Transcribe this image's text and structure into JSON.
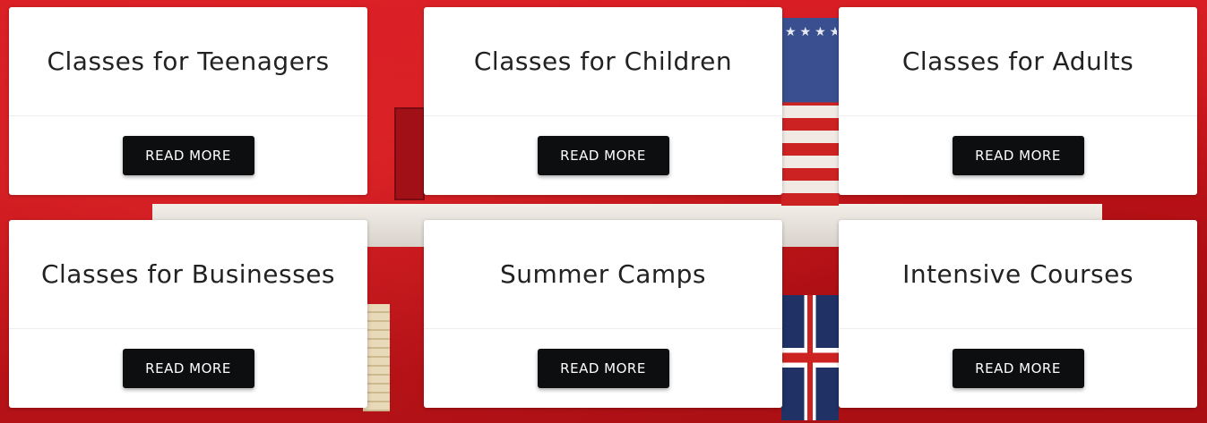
{
  "cards": [
    {
      "title": "Classes for Teenagers",
      "button": "READ MORE"
    },
    {
      "title": "Classes for Children",
      "button": "READ MORE"
    },
    {
      "title": "Classes for Adults",
      "button": "READ MORE"
    },
    {
      "title": "Classes for Businesses",
      "button": "READ MORE"
    },
    {
      "title": "Summer Camps",
      "button": "READ MORE"
    },
    {
      "title": "Intensive Courses",
      "button": "READ MORE"
    }
  ],
  "colors": {
    "background": "#c8161b",
    "card": "#ffffff",
    "button": "#0c0e10",
    "button_text": "#ffffff",
    "title_text": "#222222"
  }
}
